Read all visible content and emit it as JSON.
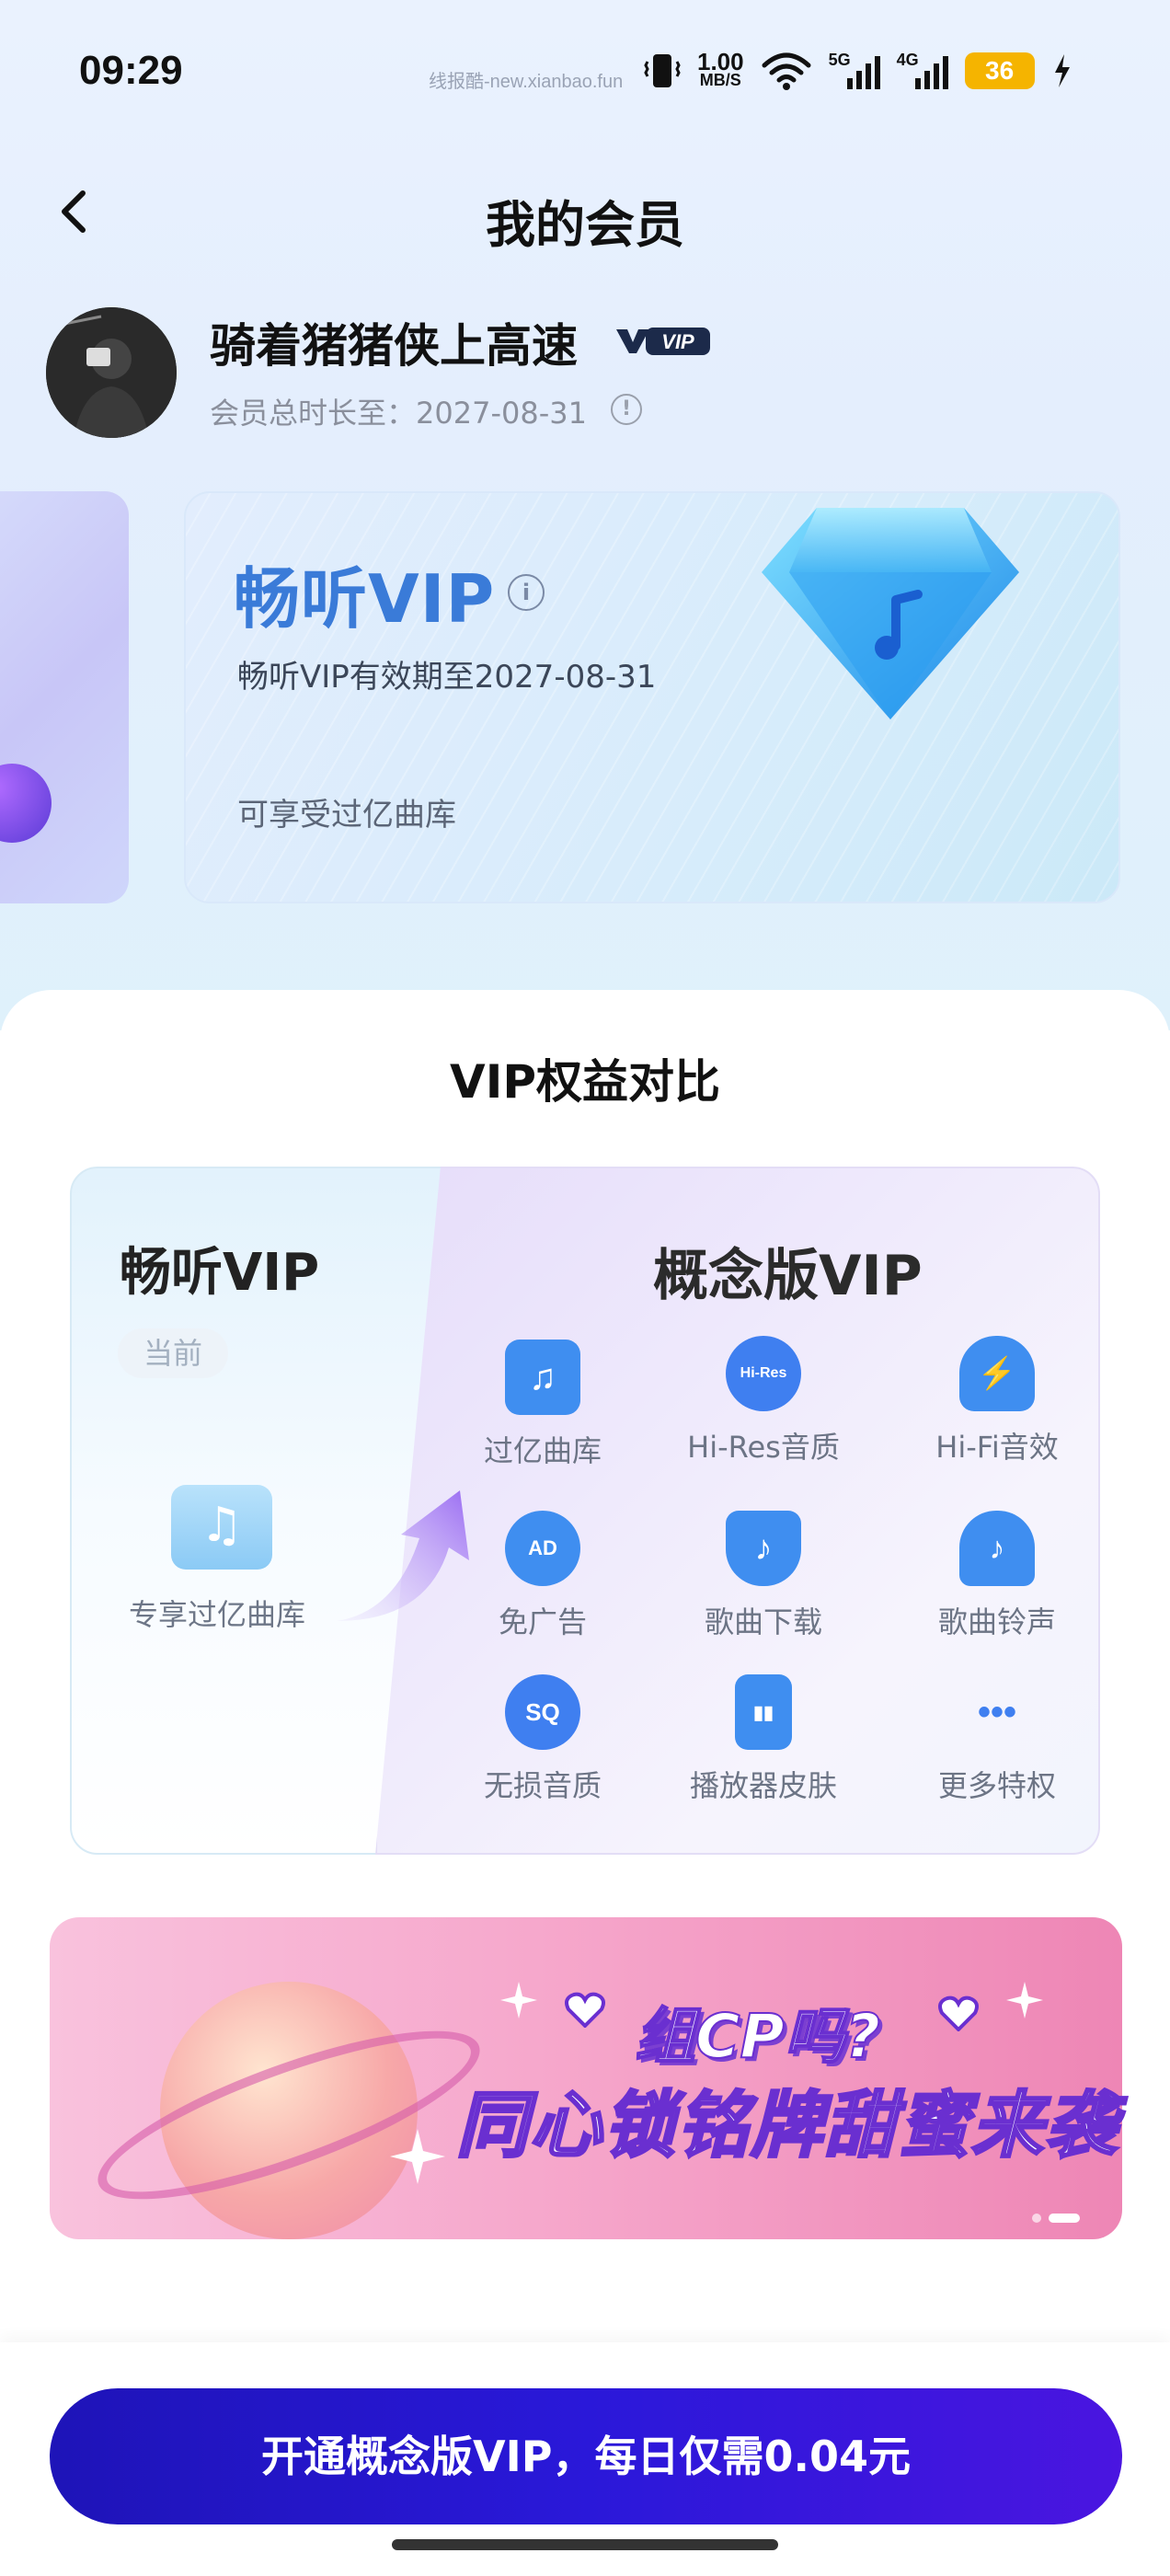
{
  "status_bar": {
    "time": "09:29",
    "watermark": "线报酷-new.xianbao.fun",
    "net_speed_value": "1.00",
    "net_speed_unit": "MB/S",
    "net1_label": "5G",
    "net2_label": "4G",
    "battery": "36"
  },
  "header": {
    "title": "我的会员",
    "back_icon": "chevron-left-icon"
  },
  "profile": {
    "username": "骑着猪猪侠上高速",
    "badge": "VIP",
    "member_until_label": "会员总时长至：2027-08-31"
  },
  "card": {
    "title": "畅听VIP",
    "expiry": "畅听VIP有效期至2027-08-31",
    "benefit": "可享受过亿曲库"
  },
  "compare": {
    "title": "VIP权益对比",
    "left_title": "畅听VIP",
    "current_tag": "当前",
    "left_benefit": "专享过亿曲库",
    "right_title": "概念版VIP",
    "features": [
      {
        "label": "过亿曲库",
        "icon": "music-library-icon",
        "glyph": "♫"
      },
      {
        "label": "Hi-Res音质",
        "icon": "hi-res-icon",
        "glyph": "Hi-Res"
      },
      {
        "label": "Hi-Fi音效",
        "icon": "headphones-icon",
        "glyph": "⚡"
      },
      {
        "label": "免广告",
        "icon": "no-ads-icon",
        "glyph": "AD"
      },
      {
        "label": "歌曲下载",
        "icon": "download-icon",
        "glyph": "♪"
      },
      {
        "label": "歌曲铃声",
        "icon": "bell-icon",
        "glyph": "♪"
      },
      {
        "label": "无损音质",
        "icon": "sq-icon",
        "glyph": "SQ"
      },
      {
        "label": "播放器皮肤",
        "icon": "player-skin-icon",
        "glyph": "▮▮"
      },
      {
        "label": "更多特权",
        "icon": "more-icon",
        "glyph": "•••"
      }
    ]
  },
  "banner": {
    "line1": "组CP吗?",
    "line2": "同心锁铭牌甜蜜来袭"
  },
  "cta": {
    "label": "开通概念版VIP，每日仅需0.04元"
  },
  "colors": {
    "accent": "#2a18d9",
    "card_title": "#3a7bd8",
    "feature_icon": "#4a8ff0"
  }
}
